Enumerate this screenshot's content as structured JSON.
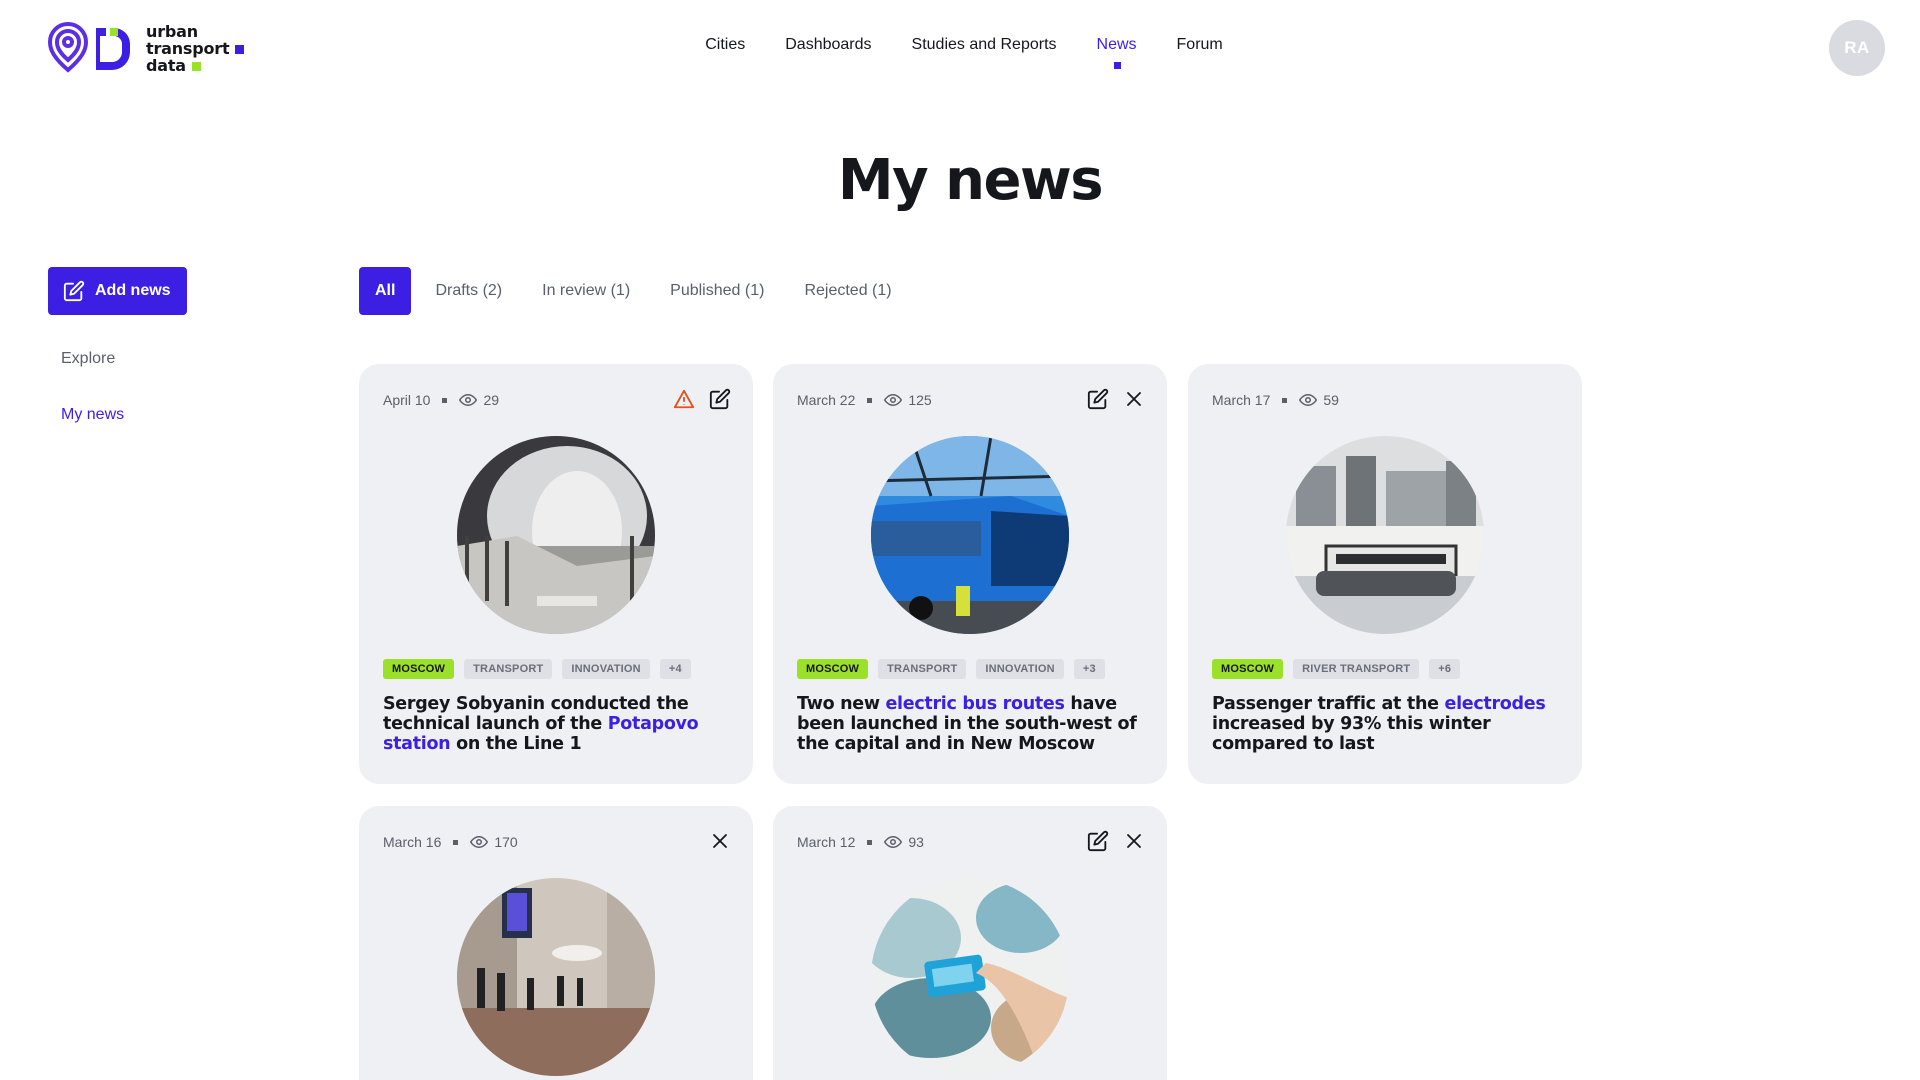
{
  "brand": {
    "line1": "urban",
    "line2": "transport",
    "line3": "data",
    "accent_color": "#3d1fe3",
    "green_color": "#9be12a"
  },
  "nav": {
    "items": [
      {
        "label": "Cities",
        "active": false
      },
      {
        "label": "Dashboards",
        "active": false
      },
      {
        "label": "Studies and Reports",
        "active": false
      },
      {
        "label": "News",
        "active": true
      },
      {
        "label": "Forum",
        "active": false
      }
    ]
  },
  "user": {
    "initials": "RA"
  },
  "page": {
    "title": "My news"
  },
  "sidebar": {
    "add_button": "Add news",
    "links": [
      {
        "label": "Explore",
        "active": false
      },
      {
        "label": "My news",
        "active": true
      }
    ]
  },
  "filters": {
    "tabs": [
      {
        "label": "All",
        "active": true
      },
      {
        "label": "Drafts (2)",
        "active": false
      },
      {
        "label": "In review (1)",
        "active": false
      },
      {
        "label": "Published (1)",
        "active": false
      },
      {
        "label": "Rejected (1)",
        "active": false
      }
    ]
  },
  "cards": [
    {
      "date": "April 10",
      "views": "29",
      "actions": [
        "warning-icon",
        "edit-icon"
      ],
      "tags": [
        "MOSCOW",
        "TRANSPORT",
        "INNOVATION",
        "+4"
      ],
      "title_before": "Sergey Sobyanin conducted the technical launch of the ",
      "title_highlight": "Potapovo station",
      "title_after": " on the Line 1"
    },
    {
      "date": "March 22",
      "views": "125",
      "actions": [
        "edit-icon",
        "close-icon"
      ],
      "tags": [
        "MOSCOW",
        "TRANSPORT",
        "INNOVATION",
        "+3"
      ],
      "title_before": "Two new ",
      "title_highlight": "electric bus routes",
      "title_after": " have been launched in the south-west of the capital and in New Moscow"
    },
    {
      "date": "March 17",
      "views": "59",
      "actions": [],
      "tags": [
        "MOSCOW",
        "RIVER TRANSPORT",
        "+6"
      ],
      "title_before": "Passenger traffic at the ",
      "title_highlight": "electrodes",
      "title_after": " increased by 93% this winter compared to last"
    },
    {
      "date": "March 16",
      "views": "170",
      "actions": [
        "close-icon"
      ],
      "tags": [],
      "title_before": "",
      "title_highlight": "",
      "title_after": ""
    },
    {
      "date": "March 12",
      "views": "93",
      "actions": [
        "edit-icon",
        "close-icon"
      ],
      "tags": [],
      "title_before": "",
      "title_highlight": "",
      "title_after": ""
    }
  ]
}
